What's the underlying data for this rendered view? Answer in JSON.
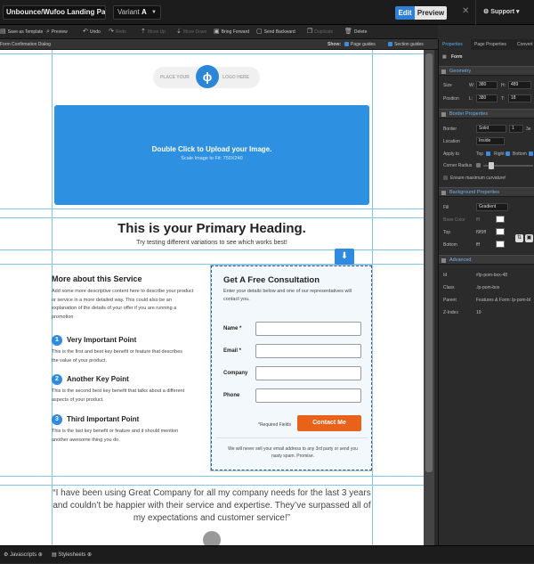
{
  "topbar": {
    "page_name": "Unbounce/Wufoo Landing Page",
    "variant_label": "Variant",
    "variant_value": "A",
    "edit_label": "Edit",
    "preview_label": "Preview",
    "support_label": "Support"
  },
  "toolbar": {
    "save_template": "Save as Template",
    "preview": "Preview",
    "undo": "Undo",
    "redo": "Redo",
    "move_up": "Move Up",
    "move_down": "Move Down",
    "bring_forward": "Bring Forward",
    "send_backward": "Send Backward",
    "duplicate": "Duplicate",
    "delete": "Delete"
  },
  "subbar": {
    "dialog": "Form Confirmation Dialog",
    "show_label": "Show:",
    "page_guides": "Page guides",
    "section_guides": "Section guides"
  },
  "page": {
    "logo_left": "PLACE YOUR",
    "logo_right": "LOGO HERE",
    "hero_title": "Double Click to Upload your Image.",
    "hero_sub": "Scale Image to Fit: 750X240",
    "primary_heading": "This is your Primary Heading.",
    "primary_sub": "Try testing different variations to see which works best!",
    "service_heading": "More about this Service",
    "service_text": "Add some more descriptive content here to describe your product or service in a more detailed way. This could also be an explanation of the details of your offer if you are running a promotion",
    "points": [
      {
        "num": "1",
        "title": "Very Important Point",
        "text": "This is the first and best key benefit or feature that describes the value of your product."
      },
      {
        "num": "2",
        "title": "Another Key Point",
        "text": "This is the second best key benefit that talks about a different aspects of your product."
      },
      {
        "num": "3",
        "title": "Third Important Point",
        "text": "This is the last key benefit or feature and it should mention another awesome thing you do."
      }
    ],
    "quote": "“I have been using Great Company for all my company needs for the last 3 years and couldn’t be happier with their service and expertise. They’ve surpassed all of my expectations and customer service!”"
  },
  "form": {
    "title": "Get A Free Consultation",
    "subtitle": "Enter your details below and one of our representatives will contact you.",
    "fields": [
      "Name *",
      "Email *",
      "Company",
      "Phone"
    ],
    "required_note": "*Required Fields",
    "cta_label": "Contact Me",
    "privacy": "We will never sell your email address to any 3rd party or send you nasty spam. Promise."
  },
  "bottombar": {
    "javascripts": "Javascripts",
    "stylesheets": "Stylesheets"
  },
  "panel": {
    "tabs": [
      "Properties",
      "Page Properties",
      "Convert"
    ],
    "element": "Form",
    "geometry": {
      "title": "Geometry",
      "size_label": "Size",
      "w_label": "W:",
      "w_value": "380",
      "h_label": "H:",
      "h_value": "489",
      "position_label": "Position",
      "l_label": "L:",
      "l_value": "380",
      "t_label": "T:",
      "t_value": "18"
    },
    "border": {
      "title": "Border Properties",
      "border_label": "Border",
      "style_value": "Solid",
      "width_value": "1",
      "color_value": "3e",
      "location_label": "Location",
      "location_value": "Inside",
      "apply_label": "Apply to",
      "apply_top": "Top",
      "apply_right": "Right",
      "apply_bottom": "Bottom",
      "radius_label": "Corner Radius",
      "ensure_label": "Ensure maximum curvature!"
    },
    "background": {
      "title": "Background Properties",
      "fill_label": "Fill",
      "fill_value": "Gradient",
      "base_label": "Base Color",
      "base_value": "fff",
      "top_label": "Top",
      "top_value": "f9f9ff",
      "bottom_label": "Bottom",
      "bottom_value": "fff"
    },
    "advanced": {
      "title": "Advanced",
      "id_label": "Id",
      "id_value": "#lp-pom-box-48",
      "class_label": "Class",
      "class_value": ".lp-pom-box",
      "parent_label": "Parent",
      "parent_value": "Features & Form: lp-pom-bl",
      "zindex_label": "Z-Index",
      "zindex_value": "19"
    }
  },
  "colors": {
    "accent": "#2f7fd4",
    "cta": "#e8621a",
    "guide": "#7cc8e6"
  }
}
